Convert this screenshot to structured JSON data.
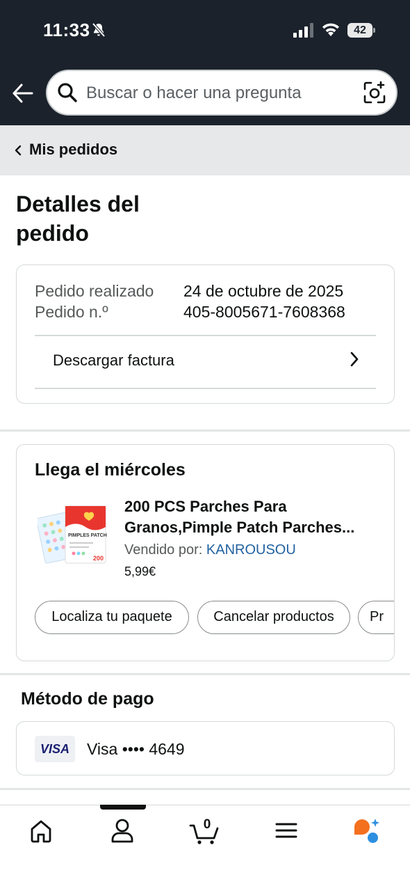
{
  "status_bar": {
    "time": "11:33",
    "battery": "42"
  },
  "header": {
    "search_placeholder": "Buscar o hacer una pregunta"
  },
  "breadcrumb": {
    "label": "Mis pedidos"
  },
  "page": {
    "title": "Detalles del pedido"
  },
  "order_summary": {
    "placed_label": "Pedido realizado",
    "placed_value": "24 de octubre de 2025",
    "number_label": "Pedido n.º",
    "number_value": "405-8005671-7608368",
    "invoice_label": "Descargar factura"
  },
  "shipment": {
    "arrival_label": "Llega el miércoles",
    "product": {
      "title_line1": "200 PCS Parches Para",
      "title_line2": "Granos,Pimple Patch Parches...",
      "seller_prefix": "Vendido por:",
      "seller_name": "KANROUSOU",
      "price": "5,99€",
      "image_text": "PIMPLES PATCH",
      "image_count": "200"
    },
    "actions": [
      "Localiza tu paquete",
      "Cancelar productos",
      "Pr"
    ]
  },
  "payment": {
    "section_title": "Método de pago",
    "card_brand": "VISA",
    "card_label": "Visa •••• 4649"
  },
  "bottom_nav": {
    "cart_count": "0",
    "items": [
      "home-icon",
      "account-icon",
      "cart-icon",
      "menu-icon",
      "rufus-icon"
    ]
  },
  "colors": {
    "header_bg": "#1b222c",
    "link": "#2162a1",
    "breadcrumb_bg": "#e6e8e9",
    "visa": "#1a1f71",
    "rufus_orange": "#f3701f",
    "rufus_blue": "#2d8fe0"
  }
}
